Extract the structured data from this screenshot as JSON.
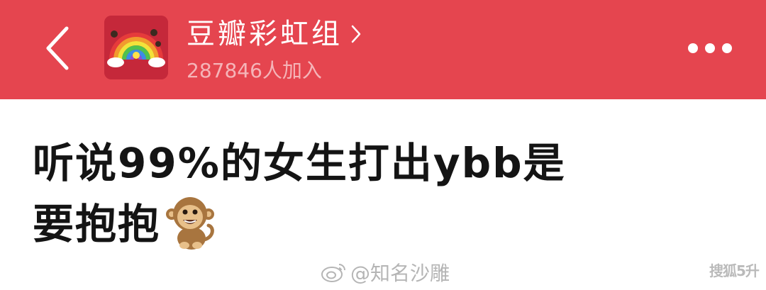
{
  "header": {
    "back_icon": "chevron-left-icon",
    "group_name": "豆瓣彩虹组",
    "group_name_chevron_icon": "chevron-right-icon",
    "member_count": "287846人加入",
    "more_icon": "more-dots-icon",
    "background_color": "#e5454f",
    "avatar_icon": "rainbow-avatar-icon"
  },
  "post": {
    "title_line1": "听说99%的女生打出ybb是",
    "title_line2": "要抱抱",
    "emoji": "monkey-emoji",
    "text_color": "#141414"
  },
  "watermark": {
    "icon": "weibo-icon",
    "text": "@知名沙雕",
    "corner_logo": "搜狐5升"
  }
}
